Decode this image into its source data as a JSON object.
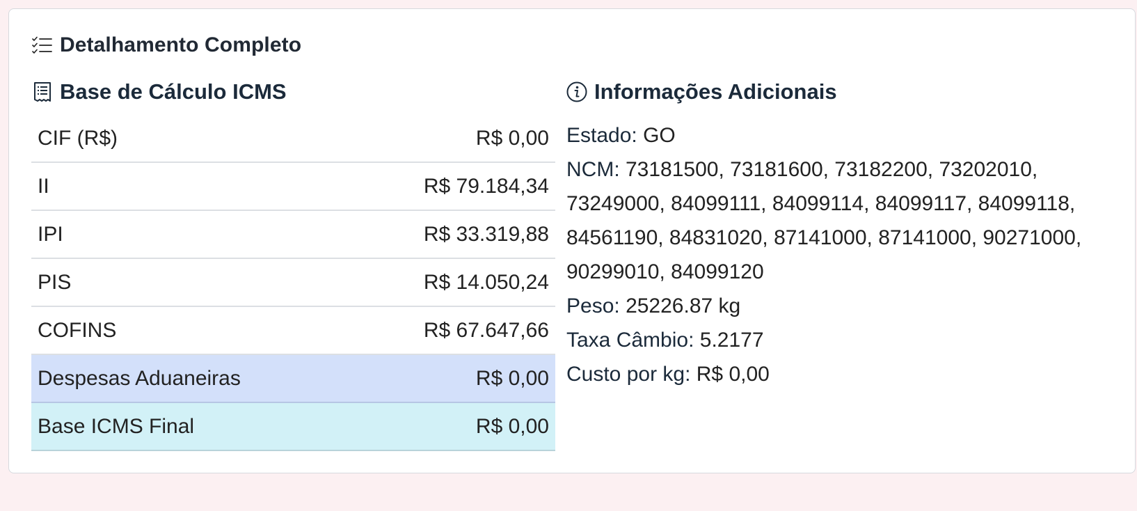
{
  "card": {
    "title": "Detalhamento Completo",
    "icon": "list-check-icon"
  },
  "left": {
    "title": "Base de Cálculo ICMS",
    "icon": "receipt-icon",
    "rows": [
      {
        "label": "CIF (R$)",
        "value": "R$ 0,00"
      },
      {
        "label": "II",
        "value": "R$ 79.184,34"
      },
      {
        "label": "IPI",
        "value": "R$ 33.319,88"
      },
      {
        "label": "PIS",
        "value": "R$ 14.050,24"
      },
      {
        "label": "COFINS",
        "value": "R$ 67.647,66"
      },
      {
        "label": "Despesas Aduaneiras",
        "value": "R$ 0,00"
      },
      {
        "label": "Base ICMS Final",
        "value": "R$ 0,00"
      }
    ]
  },
  "right": {
    "title": "Informações Adicionais",
    "icon": "info-circle-icon",
    "estado": {
      "label": "Estado:",
      "value": "GO"
    },
    "ncm": {
      "label": "NCM:",
      "value": "73181500, 73181600, 73182200, 73202010, 73249000, 84099111, 84099114, 84099117, 84099118, 84561190, 84831020, 87141000, 87141000, 90271000, 90299010, 84099120"
    },
    "peso": {
      "label": "Peso:",
      "value": "25226.87 kg"
    },
    "taxa": {
      "label": "Taxa Câmbio:",
      "value": "5.2177"
    },
    "custo": {
      "label": "Custo por kg:",
      "value": "R$ 0,00"
    }
  },
  "colors": {
    "page_bg": "#fcf0f2",
    "despesas_row_bg": "#d3e0fa",
    "base_row_bg": "#d2f1f7"
  }
}
